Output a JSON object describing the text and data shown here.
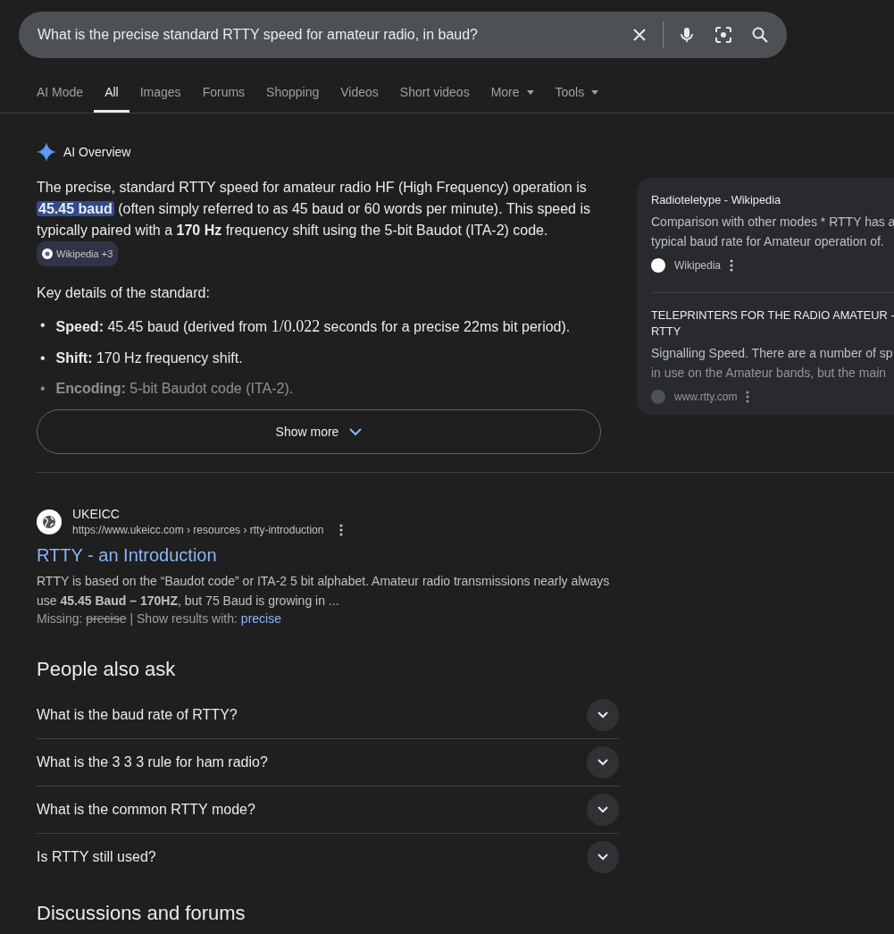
{
  "search": {
    "value": "What is the precise standard RTTY speed for amateur radio, in baud?"
  },
  "tabs": [
    {
      "label": "AI Mode",
      "selected": false,
      "kind": "tab"
    },
    {
      "label": "All",
      "selected": true,
      "kind": "tab"
    },
    {
      "label": "Images",
      "selected": false,
      "kind": "tab"
    },
    {
      "label": "Forums",
      "selected": false,
      "kind": "tab"
    },
    {
      "label": "Shopping",
      "selected": false,
      "kind": "tab"
    },
    {
      "label": "Videos",
      "selected": false,
      "kind": "tab"
    },
    {
      "label": "Short videos",
      "selected": false,
      "kind": "tab"
    },
    {
      "label": "More",
      "selected": false,
      "kind": "dropdown"
    },
    {
      "label": "Tools",
      "selected": false,
      "kind": "dropdown"
    }
  ],
  "ai_overview": {
    "title": "AI Overview",
    "summary": [
      {
        "kind": "plain",
        "text": "The precise, standard RTTY speed for amateur radio HF (High Frequency) operation is "
      },
      {
        "kind": "highlight",
        "text": "45.45 baud"
      },
      {
        "kind": "plain",
        "text": " (often simply referred to as 45 baud or 60 words per minute). This speed is typically paired with a "
      },
      {
        "kind": "bold",
        "text": "170 Hz"
      },
      {
        "kind": "plain",
        "text": " frequency shift using the 5-bit Baudot (ITA-2) code. "
      }
    ],
    "citation": "Wikipedia +3",
    "details_heading": "Key details of the standard:",
    "bullets": [
      {
        "marker": "•",
        "label": "Speed:",
        "text": " 45.45 baud (derived from ",
        "math": "1/0.022",
        "text_after": " seconds for a precise 22ms bit period).",
        "faded": false
      },
      {
        "marker": "•",
        "label": "Shift:",
        "text": " 170 Hz frequency shift.",
        "faded": false
      },
      {
        "marker": "•",
        "label": "Encoding:",
        "text": " 5-bit Baudot code (ITA-2).",
        "faded": true
      }
    ],
    "show_more": "Show more",
    "sources": [
      {
        "title_lines": [
          "Radioteletype - Wikipedia"
        ],
        "snippet_lines": [
          "Comparison with other modes * RTTY has a",
          "typical baud rate for Amateur operation of."
        ],
        "site": "Wikipedia",
        "faded": false
      },
      {
        "title_lines": [
          "TELEPRINTERS FOR THE RADIO AMATEUR -",
          "RTTY"
        ],
        "snippet_lines": [
          "Signalling Speed. There are a number of sp",
          "in use on the Amateur bands, but the main"
        ],
        "site": "www.rtty.com",
        "faded": true
      }
    ]
  },
  "result": {
    "site": "UKEICC",
    "url": "https://www.ukeicc.com › resources › rtty-introduction",
    "title": "RTTY - an Introduction",
    "snippet": "RTTY is based on the “Baudot code” or ITA-2 5 bit alphabet. Amateur radio transmissions nearly always use **45.45 Baud – 170HZ**, but 75 Baud is growing in ...",
    "missing_label": "Missing:",
    "missing_term": "precise",
    "show_with_label": "| Show results with:",
    "show_with_term": "precise"
  },
  "people_also_ask": {
    "title": "People also ask",
    "questions": [
      {
        "text": "What is the baud rate of RTTY?",
        "expanded": false
      },
      {
        "text": "What is the 3 3 3 rule for ham radio?",
        "expanded": false
      },
      {
        "text": "What is the common RTTY mode?",
        "expanded": false
      },
      {
        "text": "Is RTTY still used?",
        "expanded": false
      }
    ]
  },
  "next_section": "Discussions and forums"
}
